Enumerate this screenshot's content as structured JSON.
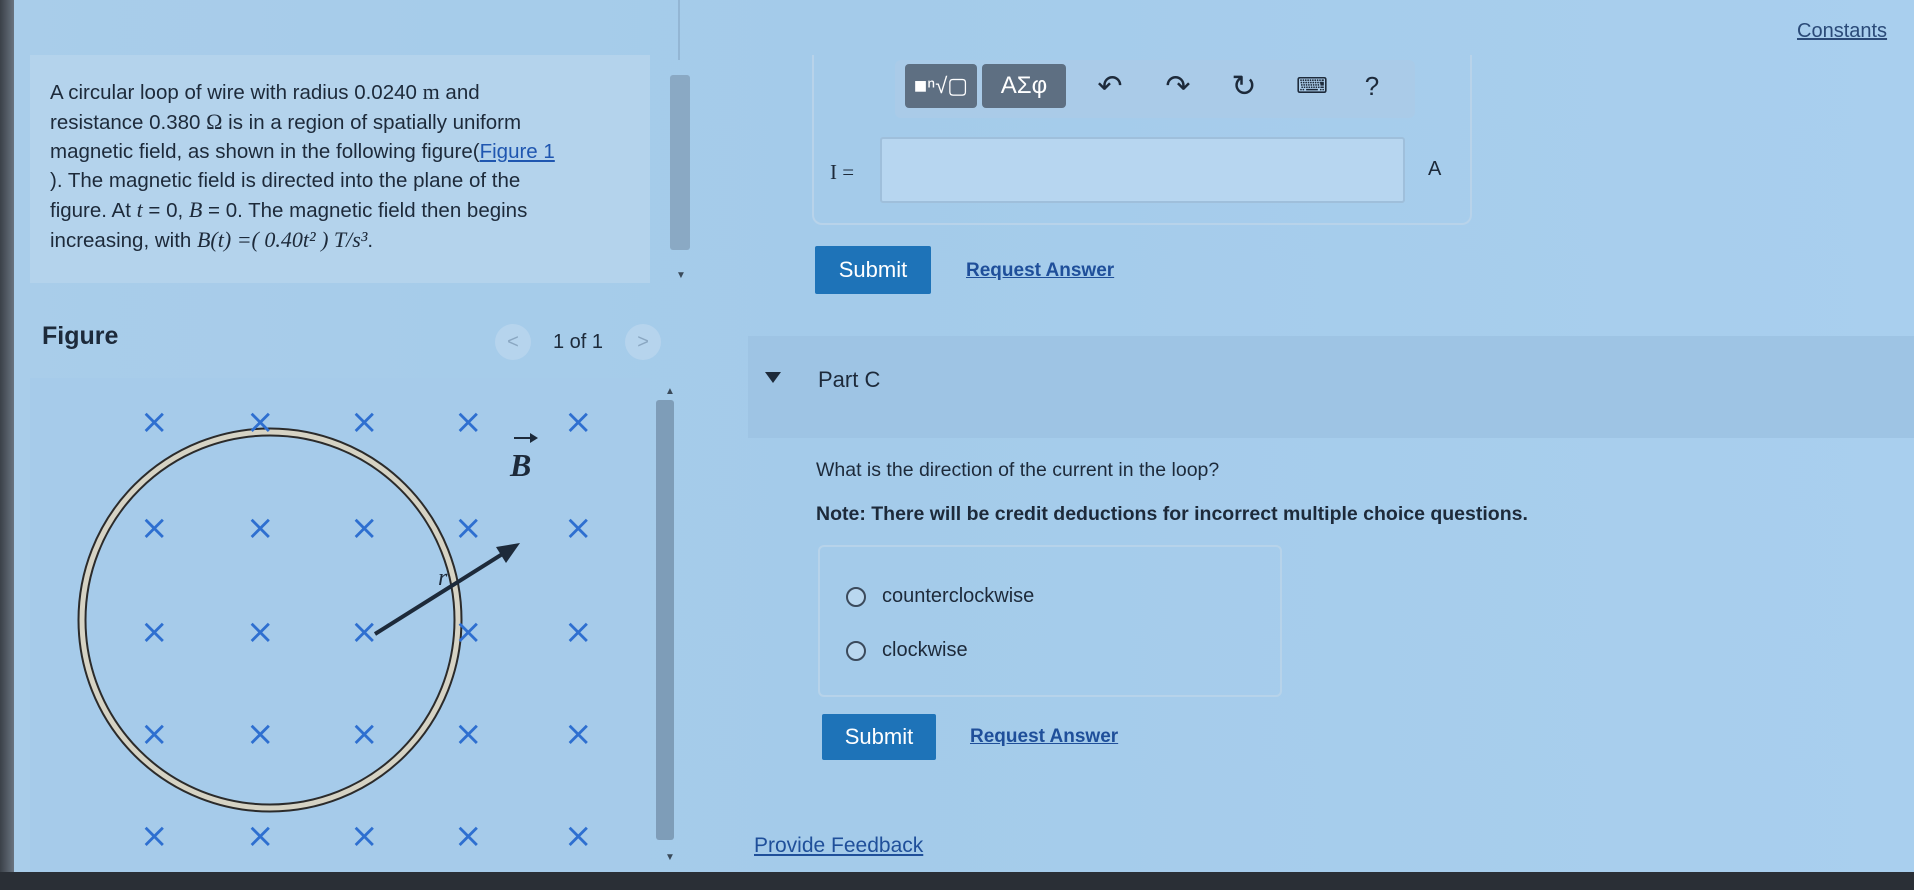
{
  "header": {
    "constants_link": "Constants"
  },
  "problem": {
    "line1_pre": "A circular loop of wire with radius 0.0240 ",
    "line1_unit": "m",
    "line1_post": " and",
    "line2_pre": "resistance 0.380 ",
    "line2_unit": "Ω",
    "line2_post": " is in a region of spatially uniform",
    "line3": "magnetic field, as shown in the following figure(",
    "figure_link": "Figure 1",
    "line4": "). The magnetic field is directed into the plane of the",
    "line5_a": "figure. At ",
    "line5_t": "t",
    "line5_b": " = 0, ",
    "line5_B": "B",
    "line5_c": " = 0. The magnetic field then begins",
    "line6_a": "increasing, with ",
    "line6_formula": "B(t) =( 0.40t² ) T/s³",
    "line6_end": "."
  },
  "figure_panel": {
    "label": "Figure",
    "prev_icon": "<",
    "next_icon": ">",
    "page_count": "1 of 1",
    "field_symbol": "B",
    "radius_symbol": "r",
    "x_marker": "×"
  },
  "answer_b": {
    "toolbar": {
      "templates_icon": "template-root-icon",
      "greek_label": "ΑΣφ",
      "help_label": "?"
    },
    "variable_label": "I =",
    "input_value": "",
    "unit_label": "A",
    "submit_label": "Submit",
    "request_answer_label": "Request Answer"
  },
  "part_c": {
    "title": "Part C",
    "question": "What is the direction of the current in the loop?",
    "note": "Note: There will be credit deductions for incorrect multiple choice questions.",
    "options": [
      "counterclockwise",
      "clockwise"
    ],
    "submit_label": "Submit",
    "request_answer_label": "Request Answer"
  },
  "footer": {
    "provide_feedback": "Provide Feedback"
  },
  "colors": {
    "accent": "#1e73b8",
    "link": "#1f4f9a",
    "x_marker": "#2e6fd0"
  }
}
